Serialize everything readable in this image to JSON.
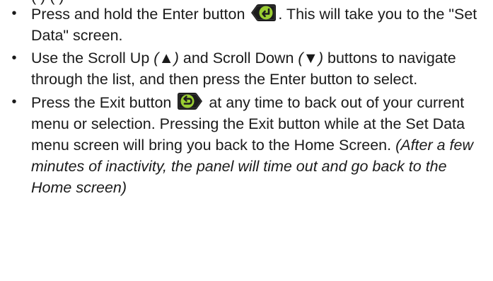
{
  "top_cutoff_text": "(     ) (      )",
  "items": [
    {
      "text_a": "Press and hold the Enter button ",
      "icon": "enter-icon",
      "text_b": ". This will take you to the \"Set Data\" screen."
    },
    {
      "text_a": "Use the Scroll Up ",
      "up_open": "(",
      "up_symbol": "▲",
      "up_close": ")",
      "text_b": " and Scroll Down ",
      "down_open": "(",
      "down_symbol": "▼",
      "down_close": ")",
      "text_c": " buttons to navigate through the list, and then press the Enter button to select."
    },
    {
      "text_a": "Press the Exit button ",
      "icon": "exit-icon",
      "text_b": " at any time to back out of your current menu or selection.  Pressing the Exit button while at the Set Data menu screen will bring you back to the Home Screen.  ",
      "italic_note": "(After a few minutes of inactivity, the panel will time out and go back to the Home screen)"
    }
  ],
  "colors": {
    "text": "#1a1a1a",
    "icon_body": "#1c1c1c",
    "icon_accent": "#9acd32"
  }
}
